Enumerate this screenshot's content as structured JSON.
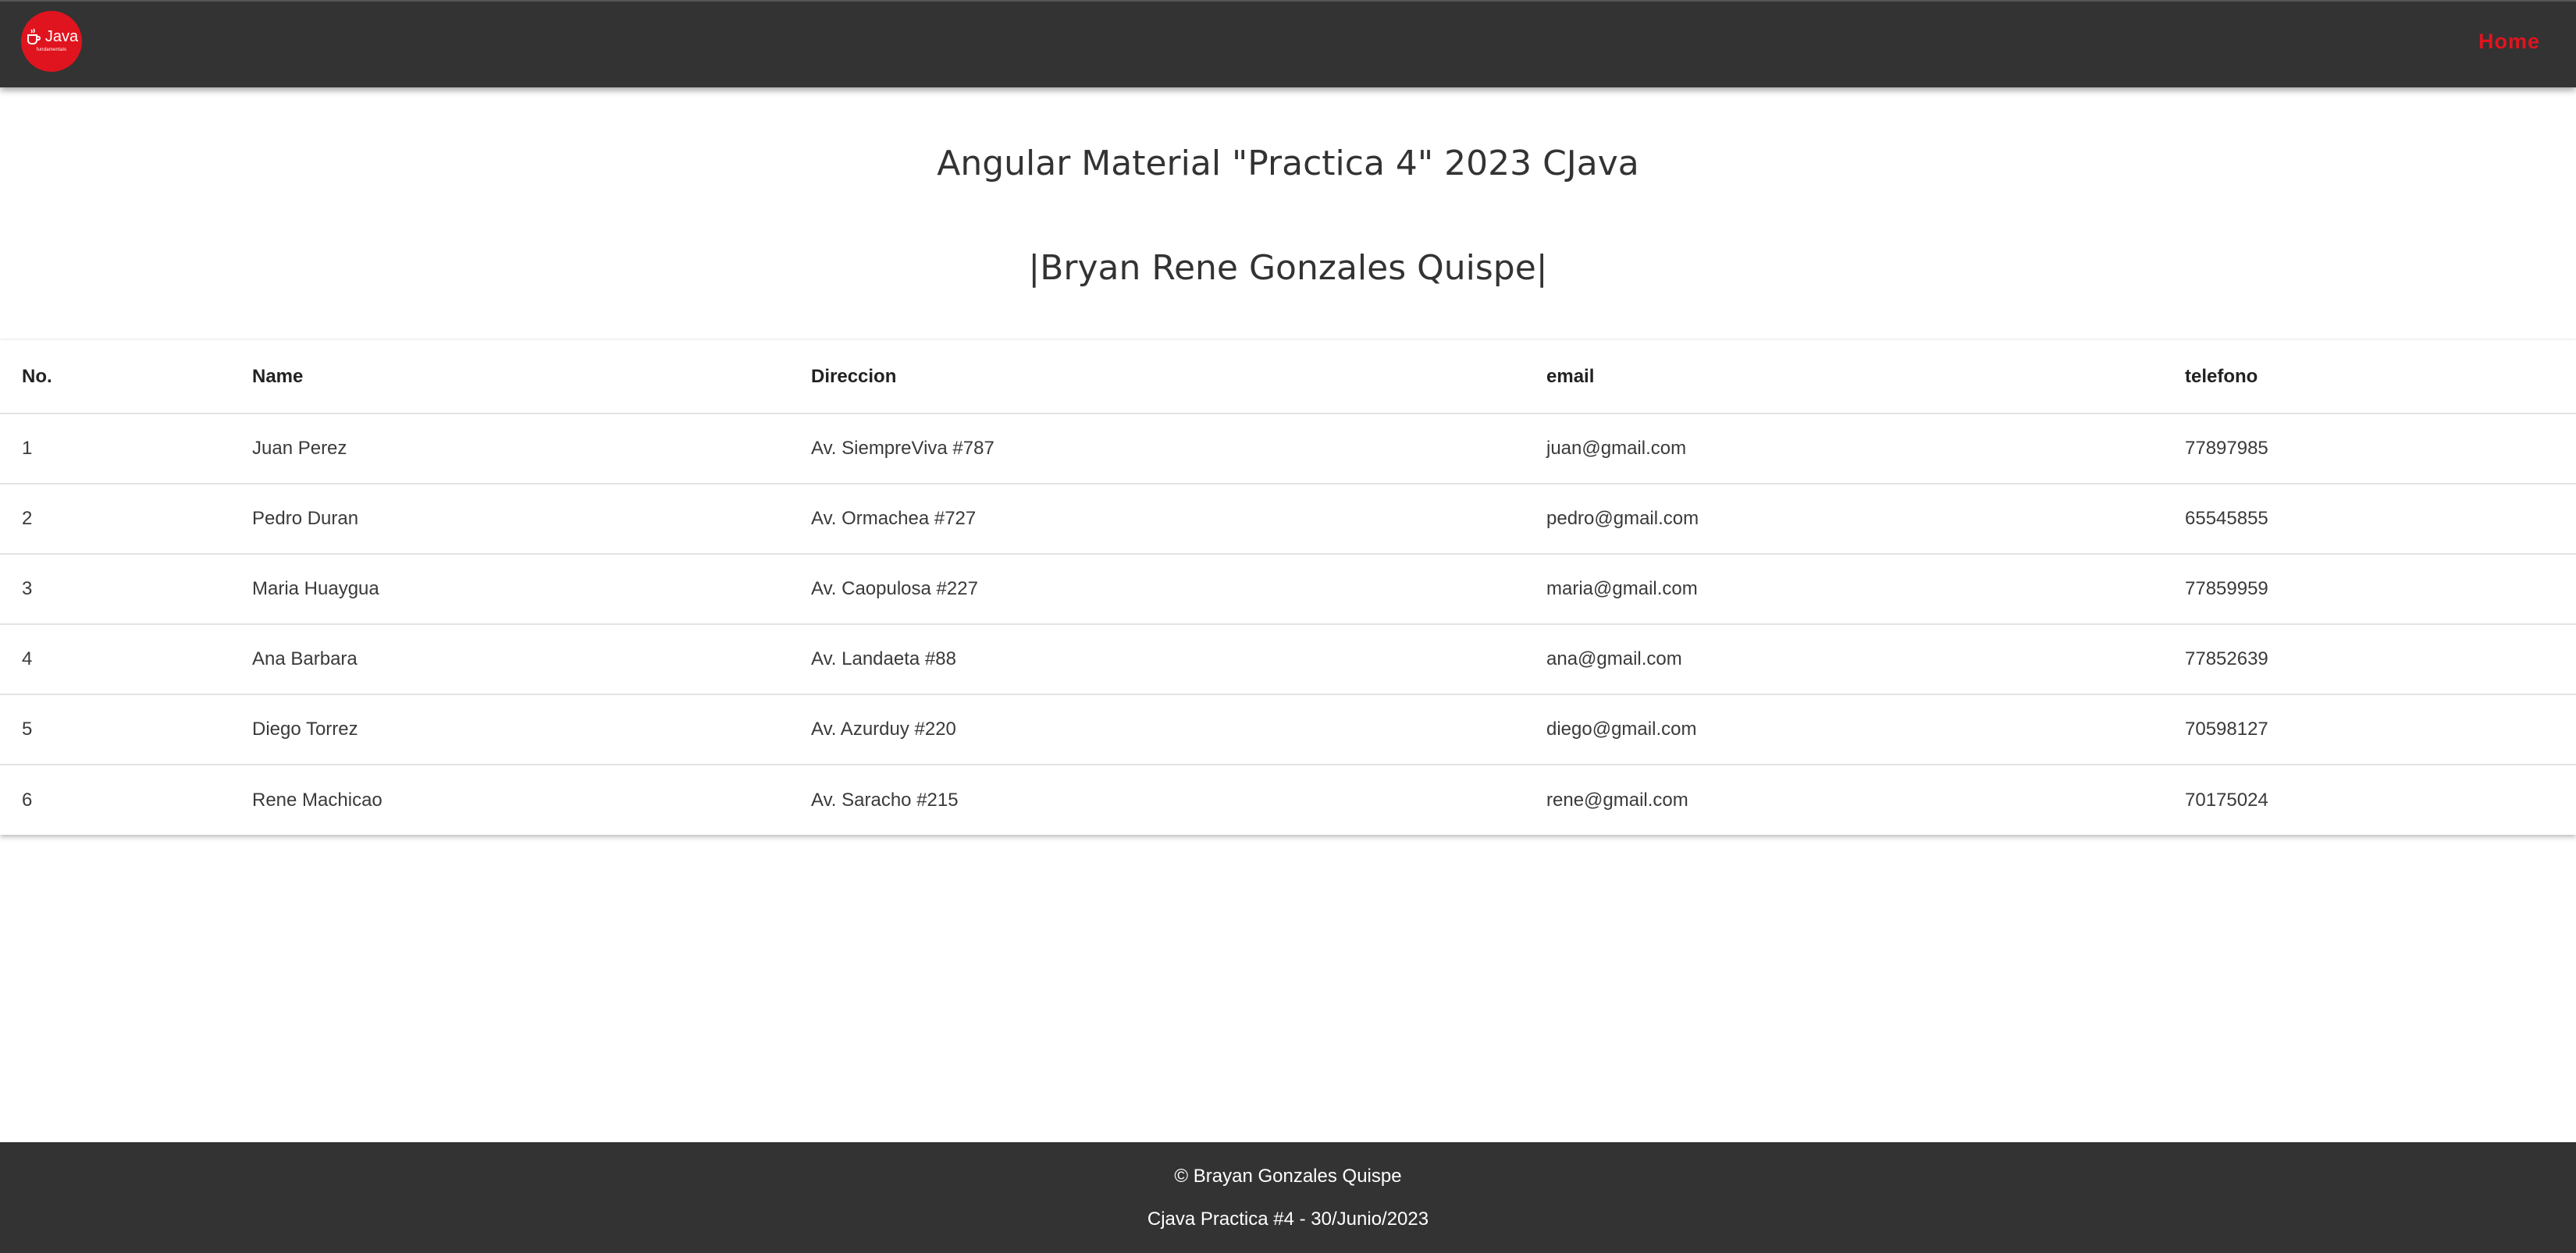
{
  "header": {
    "logo_text": "Java",
    "logo_subtext": "fundamentals",
    "home_label": "Home"
  },
  "main": {
    "title": "Angular Material \"Practica 4\" 2023 CJava",
    "subtitle": "|Bryan Rene Gonzales Quispe|"
  },
  "table": {
    "columns": [
      "No.",
      "Name",
      "Direccion",
      "email",
      "telefono"
    ],
    "rows": [
      [
        "1",
        "Juan Perez",
        "Av. SiempreViva #787",
        "juan@gmail.com",
        "77897985"
      ],
      [
        "2",
        "Pedro Duran",
        "Av. Ormachea #727",
        "pedro@gmail.com",
        "65545855"
      ],
      [
        "3",
        "Maria Huaygua",
        "Av. Caopulosa #227",
        "maria@gmail.com",
        "77859959"
      ],
      [
        "4",
        "Ana Barbara",
        "Av. Landaeta #88",
        "ana@gmail.com",
        "77852639"
      ],
      [
        "5",
        "Diego Torrez",
        "Av. Azurduy #220",
        "diego@gmail.com",
        "70598127"
      ],
      [
        "6",
        "Rene Machicao",
        "Av. Saracho #215",
        "rene@gmail.com",
        "70175024"
      ]
    ]
  },
  "footer": {
    "line1": "© Brayan Gonzales Quispe",
    "line2": "Cjava Practica #4 - 30/Junio/2023"
  },
  "colors": {
    "bar": "#333333",
    "accent": "#e0141e"
  },
  "icons": {
    "logo": "java-cup-icon"
  }
}
